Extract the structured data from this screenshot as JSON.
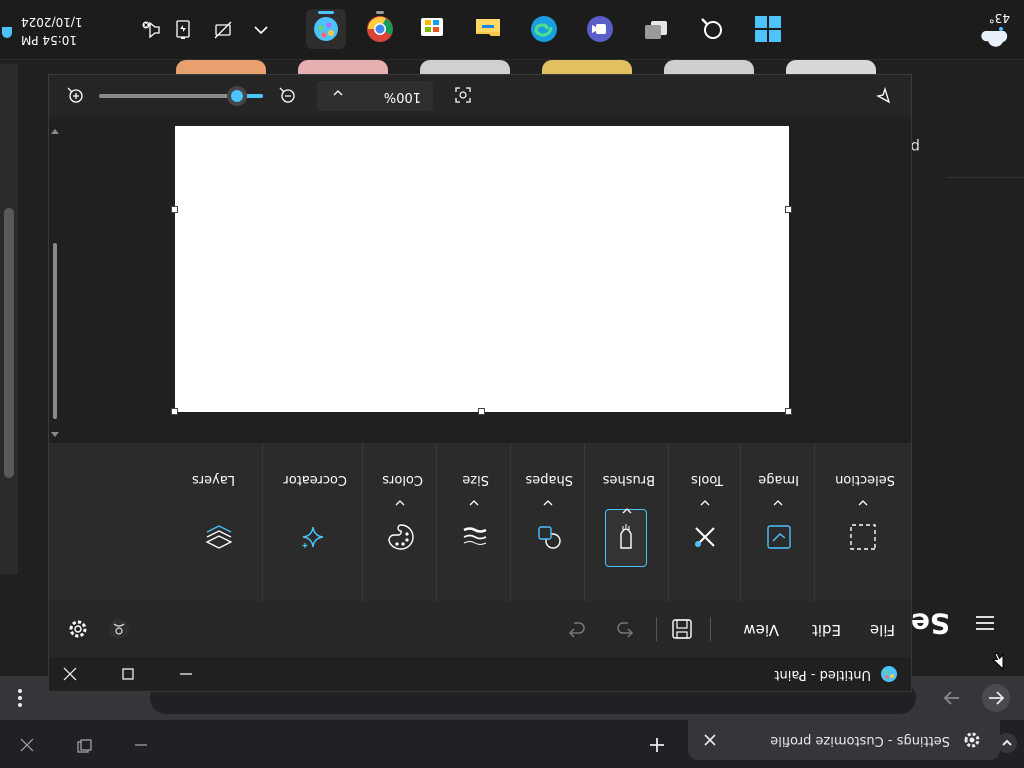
{
  "taskbar": {
    "weather_temp": "43°",
    "clock_time": "10:54 PM",
    "clock_date": "1/10/2024",
    "apps": [
      {
        "name": "start",
        "icon": "windows-logo-icon"
      },
      {
        "name": "search",
        "icon": "search-icon"
      },
      {
        "name": "task-view",
        "icon": "task-view-icon"
      },
      {
        "name": "teams",
        "icon": "teams-icon"
      },
      {
        "name": "edge",
        "icon": "edge-icon"
      },
      {
        "name": "file-explorer",
        "icon": "folder-icon"
      },
      {
        "name": "store",
        "icon": "store-icon"
      },
      {
        "name": "chrome",
        "icon": "chrome-icon"
      },
      {
        "name": "paint",
        "icon": "paint-icon"
      }
    ]
  },
  "browser": {
    "tab_title": "Settings - Customize profile",
    "settings_title": "Set",
    "side_letter": "p"
  },
  "paint": {
    "window_title": "Untitled - Paint",
    "menu": {
      "file": "File",
      "edit": "Edit",
      "view": "View"
    },
    "ribbon": {
      "selection": "Selection",
      "image": "Image",
      "tools": "Tools",
      "brushes": "Brushes",
      "shapes": "Shapes",
      "size": "Size",
      "colors": "Colors",
      "cocreator": "Cocreator",
      "layers": "Layers"
    },
    "status": {
      "zoom": "100%",
      "zoom_level": 100
    }
  },
  "colors": {
    "accent": "#4cc2ff",
    "background": "#202020",
    "ribbon": "#2b2b2b",
    "canvas": "#ffffff"
  }
}
